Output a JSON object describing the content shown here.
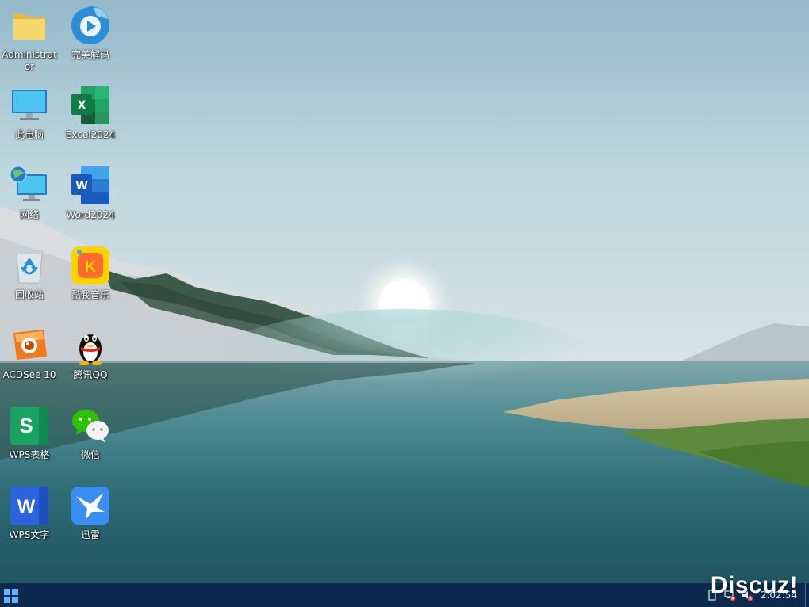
{
  "desktop": {
    "icons": [
      {
        "label": "Administrator",
        "icon": "folder-icon"
      },
      {
        "label": "完美解码",
        "icon": "media-player-icon"
      },
      {
        "label": "此电脑",
        "icon": "computer-icon"
      },
      {
        "label": "Excel2024",
        "icon": "excel-icon"
      },
      {
        "label": "网络",
        "icon": "network-icon"
      },
      {
        "label": "Word2024",
        "icon": "word-icon"
      },
      {
        "label": "回收站",
        "icon": "recycle-bin-icon"
      },
      {
        "label": "酷我音乐",
        "icon": "kuwo-music-icon"
      },
      {
        "label": "ACDSee 10",
        "icon": "acdsee-icon"
      },
      {
        "label": "腾讯QQ",
        "icon": "qq-penguin-icon"
      },
      {
        "label": "WPS表格",
        "icon": "wps-spreadsheet-icon"
      },
      {
        "label": "微信",
        "icon": "wechat-icon"
      },
      {
        "label": "WPS文字",
        "icon": "wps-writer-icon"
      },
      {
        "label": "迅雷",
        "icon": "thunder-bird-icon"
      }
    ]
  },
  "taskbar": {
    "start_icon": "windows-start-icon",
    "tray_icons": [
      "battery-icon",
      "network-error-icon",
      "volume-muted-icon"
    ],
    "clock": "2:02:54"
  },
  "watermark": "Discuz!",
  "colors": {
    "taskbar": "#0b2a4c",
    "sky": "#b7d2dc",
    "water": "#2f6f76"
  }
}
